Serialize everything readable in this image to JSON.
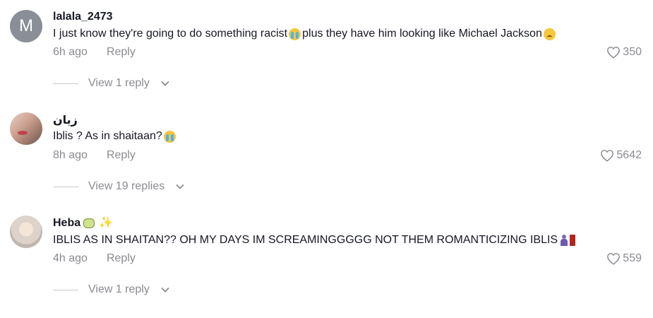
{
  "comments": [
    {
      "avatar_letter": "M",
      "username": "lalala_2473",
      "text_part1": "I just know they're going to do something racist",
      "text_part2": " plus they have him looking like Michael Jackson",
      "time": "6h ago",
      "reply_label": "Reply",
      "likes": "350",
      "view_replies": "View 1 reply"
    },
    {
      "username": "زيان",
      "text_part1": "Iblis ? As in shaitaan?",
      "time": "8h ago",
      "reply_label": "Reply",
      "likes": "5642",
      "view_replies": "View 19 replies"
    },
    {
      "username": "Heba",
      "text_part1": "IBLIS AS IN SHAITAN?? OH MY DAYS IM SCREAMINGGGGG NOT THEM ROMANTICIZING IBLIS",
      "time": "4h ago",
      "reply_label": "Reply",
      "likes": "559",
      "view_replies": "View 1 reply"
    }
  ],
  "icons": {
    "like": "heart-outline-icon",
    "expand": "chevron-down-icon"
  },
  "colors": {
    "text": "#161823",
    "muted": "#8a8b91",
    "avatar_letter_bg": "#8a8f97"
  }
}
